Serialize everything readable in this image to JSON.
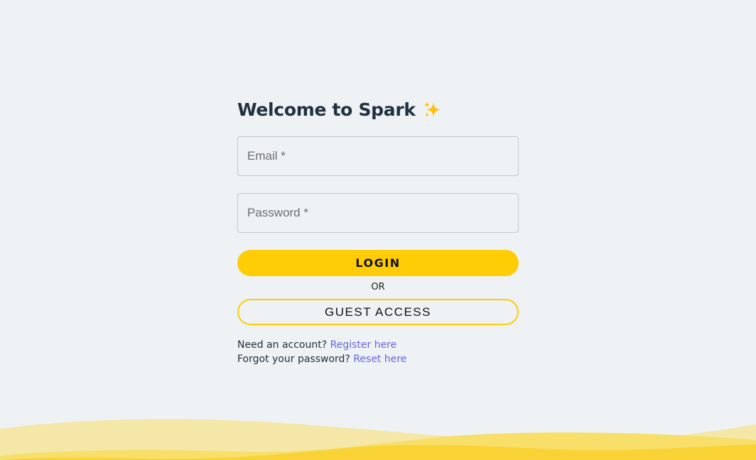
{
  "login": {
    "title": "Welcome to Spark",
    "email_placeholder": "Email *",
    "password_placeholder": "Password *",
    "login_label": "LOGIN",
    "or_label": "OR",
    "guest_label": "GUEST ACCESS",
    "register_prompt": "Need an account?",
    "register_link": "Register here",
    "forgot_prompt": "Forgot your password?",
    "reset_link": "Reset here"
  },
  "icons": {
    "title_icon": "sparkles-icon"
  },
  "colors": {
    "background": "#eef2f5",
    "accent": "#ffcd05",
    "title": "#22303f",
    "link": "#6366e0",
    "wave_light": "#f4e7a8",
    "wave_mid": "#f7df6a",
    "wave_dark": "#f9d236"
  }
}
